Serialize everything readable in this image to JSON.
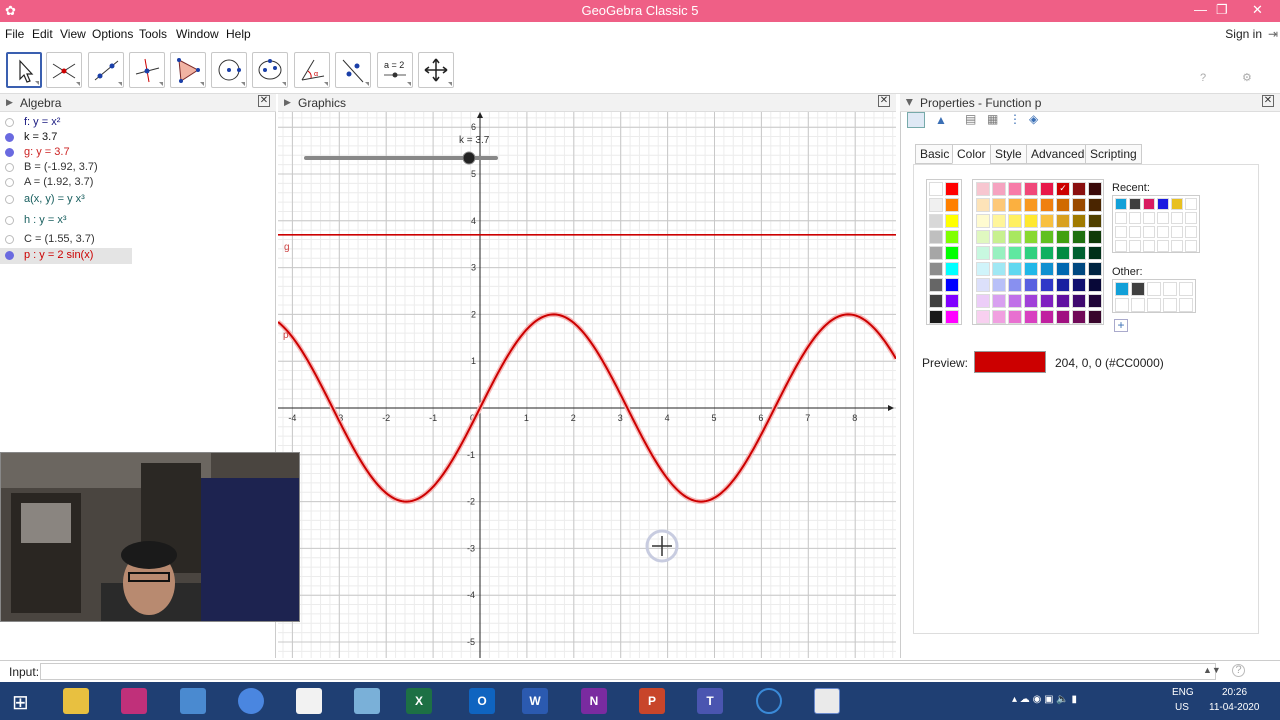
{
  "window": {
    "title": "GeoGebra Classic 5",
    "app_icon": "geogebra-icon"
  },
  "menu": {
    "items": [
      "File",
      "Edit",
      "View",
      "Options",
      "Tools",
      "Window",
      "Help"
    ],
    "sign_in": "Sign in"
  },
  "toolbar": {
    "tools": [
      "move-tool-icon",
      "point-tool-icon",
      "line-tool-icon",
      "perpendicular-line-tool-icon",
      "polygon-tool-icon",
      "circle-tool-icon",
      "ellipse-tool-icon",
      "angle-tool-icon",
      "reflect-tool-icon",
      "slider-tool-icon",
      "move-graphics-view-icon"
    ],
    "slider_label": "a = 2"
  },
  "algebra": {
    "title": "Algebra",
    "rows": [
      {
        "text": "f: y = x²",
        "color": "#1a1a80",
        "dot": false
      },
      {
        "text": "k = 3.7",
        "color": "#111111",
        "dot": true
      },
      {
        "text": "g: y = 3.7",
        "color": "#cc2222",
        "dot": true
      },
      {
        "text": "B = (-1.92, 3.7)",
        "color": "#333333",
        "dot": false
      },
      {
        "text": "A = (1.92, 3.7)",
        "color": "#333333",
        "dot": false
      },
      {
        "text": "a(x, y) = y x³",
        "color": "#1a6060",
        "dot": false
      },
      {
        "text": "h : y = x³",
        "color": "#1a6060",
        "dot": false
      },
      {
        "text": "C = (1.55, 3.7)",
        "color": "#333333",
        "dot": false
      },
      {
        "text": "p : y = 2 sin(x)",
        "color": "#cc0000",
        "dot": true
      }
    ]
  },
  "graphics": {
    "title": "Graphics",
    "slider_label": "k = 3.7",
    "slider_value": 3.7,
    "label_g": "g",
    "label_p": "p",
    "x_ticks": [
      "-4",
      "-3",
      "-2",
      "-1",
      "0",
      "1",
      "2",
      "3",
      "4",
      "5",
      "6",
      "7",
      "8"
    ],
    "y_ticks": [
      "6",
      "5",
      "4",
      "3",
      "2",
      "1",
      "-1",
      "-2",
      "-3",
      "-4",
      "-5"
    ]
  },
  "chart_data": {
    "type": "line",
    "series": [
      {
        "name": "p",
        "expression": "2 sin(x)",
        "color": "#cc0000"
      },
      {
        "name": "g",
        "expression": "3.7",
        "color": "#cc0000"
      }
    ],
    "xlim": [
      -4.3,
      9
    ],
    "ylim": [
      -5.3,
      6.2
    ],
    "grid": true
  },
  "properties": {
    "title": "Properties - Function p",
    "tabs": [
      "Basic",
      "Color",
      "Style",
      "Advanced",
      "Scripting"
    ],
    "active_tab": "Color",
    "recent_label": "Recent:",
    "other_label": "Other:",
    "preview_label": "Preview:",
    "preview_value": "204, 0, 0 (#CC0000)",
    "preview_color": "#CC0000",
    "recent_colors": [
      "#12a0d8",
      "#404040",
      "#d81b60",
      "#1a1ae0",
      "#e8c020"
    ],
    "other_colors": [
      "#12a0d8",
      "#404040"
    ]
  },
  "input": {
    "label": "Input:"
  },
  "taskbar": {
    "lang": "ENG",
    "region": "US",
    "time": "20:26",
    "date": "11-04-2020"
  }
}
